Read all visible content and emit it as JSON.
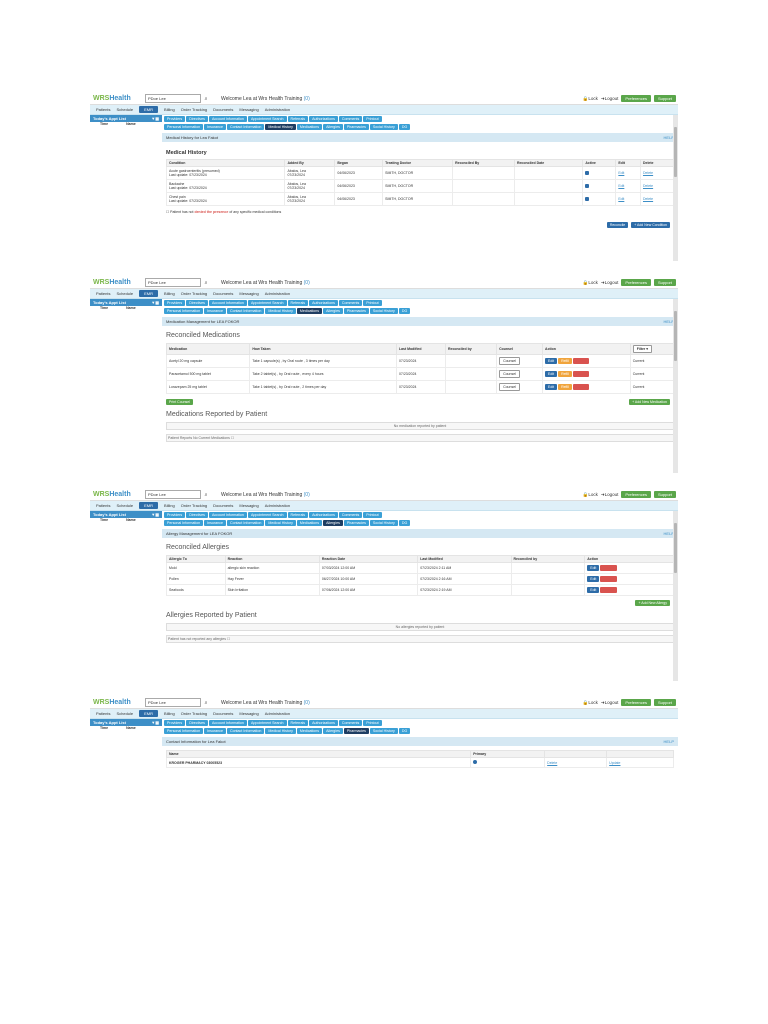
{
  "common": {
    "logo_prefix": "WRS",
    "logo_suffix": "Health",
    "search_value": "PDoe Lee",
    "welcome_text": "Welcome Lea at Wrs Health Training",
    "welcome_count": "(0)",
    "lock_label": "Lock",
    "logout_label": "Logout",
    "preferences_label": "Preferences",
    "support_label": "Support",
    "menu": [
      "Patients",
      "Schedule",
      "EMR",
      "Billing",
      "Order Tracking",
      "Documents",
      "Messaging",
      "Administration"
    ],
    "left_header": "Today's Appt List",
    "left_col_time": "Time",
    "left_col_name": "Name"
  },
  "panel1": {
    "tabs_row1": [
      "Providers",
      "Directives",
      "Account Information",
      "Appointment Search",
      "Referrals",
      "Authorizations",
      "Comments",
      "Printout"
    ],
    "tabs_row2": [
      "Personal Information",
      "Insurance",
      "Contact Information",
      "Medical History",
      "Medications",
      "Allergies",
      "Pharmacies",
      "Social History",
      "DG"
    ],
    "active_tab": "Medical History",
    "section_header": "Medical History for Lea Fakot",
    "help": "HELP",
    "title": "Medical History",
    "columns": [
      "Condition",
      "Added By",
      "Began",
      "Treating Doctor",
      "Reconciled By",
      "Reconciled Date",
      "Active",
      "Edit",
      "Delete"
    ],
    "rows": [
      {
        "condition": "Acute gastroenteritis (presumed)",
        "updated": "Last update: 07/23/2024",
        "added_by": "Abalos, Lea",
        "added_date": "07/23/2024",
        "began": "04/06/2023",
        "doctor": "SMITH, DOCTOR"
      },
      {
        "condition": "Backache",
        "updated": "Last update: 07/23/2024",
        "added_by": "Abalos, Lea",
        "added_date": "07/23/2024",
        "began": "04/06/2023",
        "doctor": "SMITH, DOCTOR"
      },
      {
        "condition": "Chest pain",
        "updated": "Last update: 07/23/2024",
        "added_by": "Abalos, Lea",
        "added_date": "07/23/2024",
        "began": "04/06/2023",
        "doctor": "SMITH, DOCTOR"
      }
    ],
    "edit_label": "Edit",
    "delete_label": "Delete",
    "denial_prefix": "Patient has not",
    "denial_red": "denied the presence",
    "denial_suffix": "of any specific medical conditions",
    "reconcile_btn": "Reconcile",
    "add_btn": "+ Add New Condition"
  },
  "panel2": {
    "active_tab": "Medications",
    "section_header": "Medication Management for LEA FOKOR",
    "help": "HELP",
    "title": "Reconciled Medications",
    "columns": [
      "Medication",
      "How Taken",
      "Last Modified",
      "Reconciled by",
      "Counsel",
      "Action",
      "Filter"
    ],
    "filter_value": "Active",
    "rows": [
      {
        "med": "Acetyl 20 mg capsule",
        "how": "Take 1 capsule(s) , by Oral route , 3 times per day",
        "modified": "07/23/2024",
        "status": "Current"
      },
      {
        "med": "Paracetamol 500 mg tablet",
        "how": "Take 2 tablet(s) , by Oral route , every 4 hours",
        "modified": "07/23/2024",
        "status": "Current"
      },
      {
        "med": "Lorazepam 25 mg tablet",
        "how": "Take 1 tablet(s) , by Oral route , 2 times per day",
        "modified": "07/23/2024",
        "status": "Current"
      }
    ],
    "counsel_label": "Counsel",
    "edit_label": "Edit",
    "refill_label": "Refill",
    "delete_label": "Delete",
    "print_btn": "Print Counsel",
    "add_btn": "+ Add New Medication",
    "reported_title": "Medications Reported by Patient",
    "no_reported": "No medication reported by patient",
    "footer_check": "Patient Reports No Current Medications"
  },
  "panel3": {
    "active_tab": "Allergies",
    "section_header": "Allergy Management for LEA FOKOR",
    "help": "HELP",
    "title": "Reconciled Allergies",
    "columns": [
      "Allergic To",
      "Reaction",
      "Reaction Date",
      "Last Modified",
      "Reconciled by",
      "Action"
    ],
    "rows": [
      {
        "allergen": "Mold",
        "reaction": "allergic skin reaction",
        "date": "07/03/2024 12:00 AM",
        "modified": "07/23/2024 2:11 AM"
      },
      {
        "allergen": "Pollen",
        "reaction": "Hay Fever",
        "date": "06/27/2024 10:00 AM",
        "modified": "07/23/2024 2:16 AM"
      },
      {
        "allergen": "Seafoods",
        "reaction": "Skin Irritation",
        "date": "07/06/2024 12:00 AM",
        "modified": "07/23/2024 2:19 AM"
      }
    ],
    "edit_label": "Edit",
    "delete_label": "Delete",
    "add_btn": "+ Add New Allergy",
    "reported_title": "Allergies Reported by Patient",
    "no_reported": "No allergies reported by patient",
    "footer_check": "Patient has not reported any allergies"
  },
  "panel4": {
    "active_tab": "Pharmacies",
    "section_header": "Contact Information for Lea Fakot",
    "help": "HELP",
    "columns": [
      "Name",
      "Primary"
    ],
    "pharmacy_name": "KROGER PHARMACY 03005523",
    "delete_label": "Delete",
    "update_label": "Update"
  }
}
